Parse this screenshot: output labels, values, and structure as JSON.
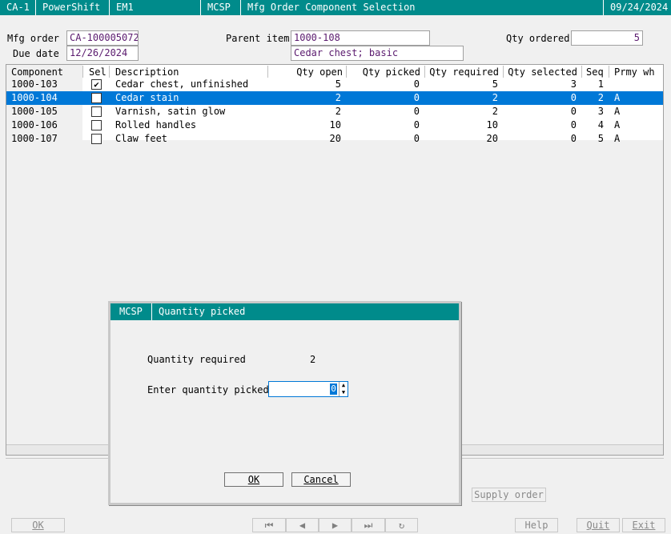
{
  "titlebar": {
    "company": "CA-1",
    "product": "PowerShift",
    "env": "EM1",
    "program": "MCSP",
    "screen_title": "Mfg Order Component Selection",
    "date": "09/24/2024"
  },
  "header": {
    "mfg_order_label": "Mfg order",
    "mfg_order_value": "CA-100005072",
    "due_date_label": "Due date",
    "due_date_value": "12/26/2024",
    "parent_item_label": "Parent item",
    "parent_item_value": "1000-108",
    "parent_desc_value": "Cedar chest; basic",
    "qty_ordered_label": "Qty ordered",
    "qty_ordered_value": "5"
  },
  "grid": {
    "columns": [
      "Component",
      "Sel",
      "Description",
      "Qty open",
      "Qty picked",
      "Qty required",
      "Qty selected",
      "Seq",
      "Prmy wh"
    ],
    "rows": [
      {
        "component": "1000-103",
        "sel": true,
        "description": "Cedar chest, unfinished",
        "qty_open": "5",
        "qty_picked": "0",
        "qty_required": "5",
        "qty_selected": "3",
        "seq": "1",
        "prmy_wh": ""
      },
      {
        "component": "1000-104",
        "sel": false,
        "description": "Cedar stain",
        "qty_open": "2",
        "qty_picked": "0",
        "qty_required": "2",
        "qty_selected": "0",
        "seq": "2",
        "prmy_wh": "A"
      },
      {
        "component": "1000-105",
        "sel": false,
        "description": "Varnish, satin glow",
        "qty_open": "2",
        "qty_picked": "0",
        "qty_required": "2",
        "qty_selected": "0",
        "seq": "3",
        "prmy_wh": "A"
      },
      {
        "component": "1000-106",
        "sel": false,
        "description": "Rolled handles",
        "qty_open": "10",
        "qty_picked": "0",
        "qty_required": "10",
        "qty_selected": "0",
        "seq": "4",
        "prmy_wh": "A"
      },
      {
        "component": "1000-107",
        "sel": false,
        "description": "Claw feet",
        "qty_open": "20",
        "qty_picked": "0",
        "qty_required": "20",
        "qty_selected": "0",
        "seq": "5",
        "prmy_wh": "A"
      }
    ],
    "selected_row": 1
  },
  "toolbar": {
    "ok_label": "OK",
    "supply_order_label": "Supply order",
    "help_label": "Help",
    "quit_label": "Quit",
    "exit_label": "Exit",
    "first_icon": "first-record-icon",
    "prev_icon": "previous-record-icon",
    "next_icon": "next-record-icon",
    "last_icon": "last-record-icon",
    "refresh_icon": "refresh-icon"
  },
  "dialog": {
    "program": "MCSP",
    "title": "Quantity picked",
    "qty_required_label": "Quantity required",
    "qty_required_value": "2",
    "enter_qty_label": "Enter quantity picked",
    "enter_qty_value": "0",
    "ok_label": "OK",
    "cancel_label": "Cancel"
  },
  "colors": {
    "titlebar_bg": "#008b8b",
    "selection_bg": "#0078d7",
    "field_text": "#5a1a6e"
  }
}
